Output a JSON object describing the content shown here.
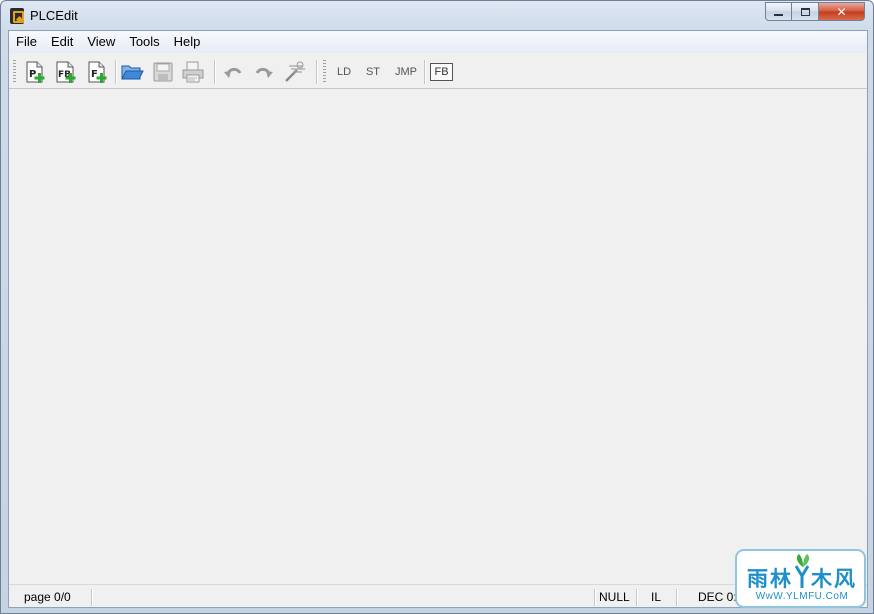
{
  "window": {
    "title": "PLCEdit",
    "app_icon": "plcedit-app-icon",
    "caption_buttons": [
      "minimize-icon",
      "maximize-icon",
      "close-icon"
    ]
  },
  "menubar": {
    "items": [
      {
        "label": "File"
      },
      {
        "label": "Edit"
      },
      {
        "label": "View"
      },
      {
        "label": "Tools"
      },
      {
        "label": "Help"
      }
    ]
  },
  "toolbar": {
    "icon_buttons": [
      {
        "icon": "new-program-icon",
        "label": "P"
      },
      {
        "icon": "new-function-block-icon",
        "label": "FB"
      },
      {
        "icon": "new-function-icon",
        "label": "F"
      },
      {
        "icon": "open-folder-icon"
      },
      {
        "icon": "save-icon"
      },
      {
        "icon": "print-icon"
      },
      {
        "icon": "undo-icon"
      },
      {
        "icon": "redo-icon"
      },
      {
        "icon": "magic-wand-icon"
      }
    ],
    "text_buttons": [
      {
        "label": "LD"
      },
      {
        "label": "ST"
      },
      {
        "label": "JMP"
      },
      {
        "label": "FB"
      }
    ]
  },
  "statusbar": {
    "page": "page 0/0",
    "value": "NULL",
    "mode": "IL",
    "number_format": "DEC 0:"
  },
  "watermark": {
    "chars": [
      "雨",
      "林",
      "木",
      "风"
    ],
    "url": "WwW.YLMFU.CoM"
  },
  "colors": {
    "accent_green": "#2ea82e",
    "toolbar_disabled": "#9a9a9a",
    "open_folder_blue": "#2b74c8",
    "watermark_blue": "#1f8fca"
  }
}
